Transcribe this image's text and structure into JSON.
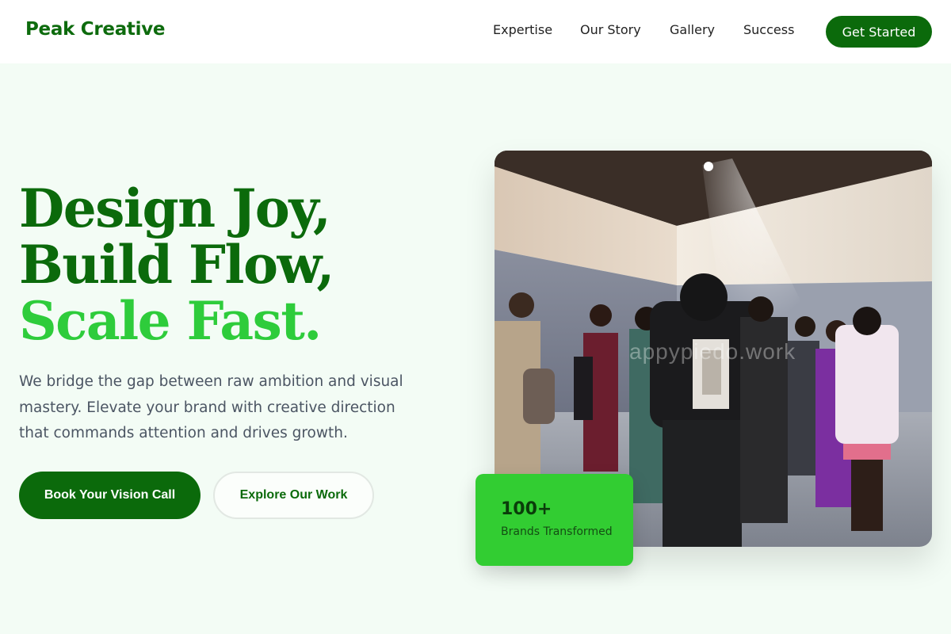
{
  "brand": {
    "name": "Peak Creative"
  },
  "nav": {
    "links": [
      "Expertise",
      "Our Story",
      "Gallery",
      "Success"
    ],
    "cta_label": "Get Started"
  },
  "hero": {
    "headline": [
      "Design Joy,",
      "Build Flow,",
      "Scale Fast."
    ],
    "subtext": "We bridge the gap between raw ambition and visual mastery. Elevate your brand with creative direction that commands attention and drives growth.",
    "primary_button": "Book Your Vision Call",
    "secondary_button": "Explore Our Work",
    "image_watermark": "appypiedo.work"
  },
  "stat": {
    "number": "100+",
    "label": "Brands Transformed"
  },
  "colors": {
    "primary_green": "#0b6a0b",
    "accent_green": "#2ecc3b",
    "stat_card_green": "#32cd32",
    "page_background": "#f3fcf5"
  }
}
